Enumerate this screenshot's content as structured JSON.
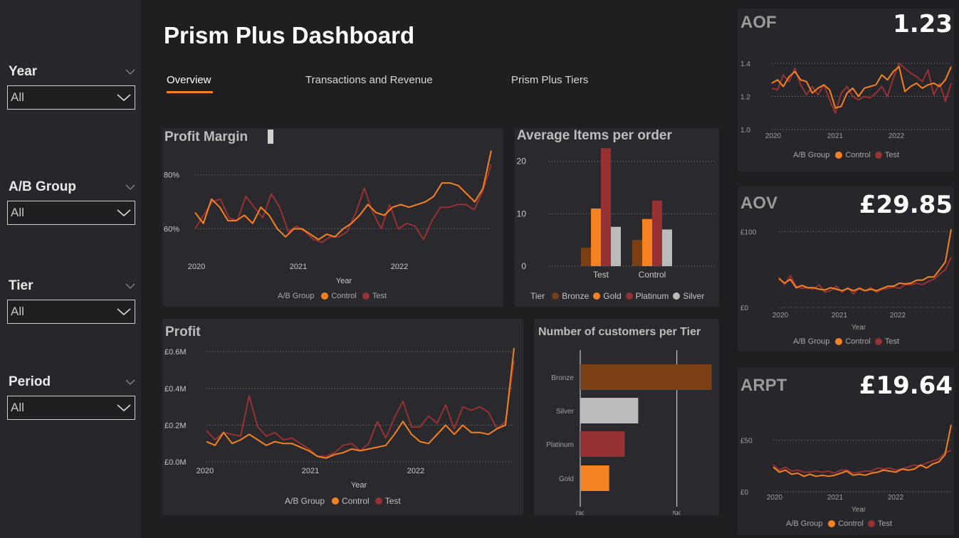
{
  "dashboard": {
    "title": "Prism Plus Dashboard",
    "tabs": [
      "Overview",
      "Transactions and Revenue",
      "Prism Plus Tiers"
    ],
    "active_tab": "Overview"
  },
  "filters": [
    {
      "label": "Year",
      "value": "All"
    },
    {
      "label": "A/B Group",
      "value": "All"
    },
    {
      "label": "Tier",
      "value": "All"
    },
    {
      "label": "Period",
      "value": "All"
    }
  ],
  "colors": {
    "control": "#f58220",
    "test": "#963233",
    "bronze": "#7a3f12",
    "gold": "#f58220",
    "platinum": "#963233",
    "silver": "#bbbbbb"
  },
  "legend": {
    "ab_title": "A/B Group",
    "control": "Control",
    "test": "Test",
    "tier_title": "Tier"
  },
  "profit_margin": {
    "title": "Profit Margin",
    "xlabel": "Year",
    "chart_data": {
      "type": "line",
      "x_ticks": [
        "2020",
        "2021",
        "2022"
      ],
      "y_ticks": [
        "60%",
        "80%"
      ],
      "ylim": [
        53,
        91
      ],
      "series": [
        {
          "name": "Control",
          "values": [
            66,
            62,
            71,
            68,
            63,
            63,
            65,
            62,
            68,
            65,
            60,
            57,
            60,
            60,
            58,
            56,
            58,
            57,
            60,
            62,
            65,
            69,
            66,
            65,
            68,
            69,
            68,
            69,
            70,
            72,
            77,
            77,
            76,
            73,
            70,
            75,
            89
          ]
        },
        {
          "name": "Test",
          "values": [
            60,
            65,
            70,
            71,
            64,
            63,
            72,
            68,
            64,
            73,
            68,
            59,
            61,
            59,
            56,
            55,
            57,
            57,
            59,
            66,
            75,
            66,
            60,
            69,
            60,
            62,
            61,
            56,
            63,
            68,
            68,
            69,
            69,
            67,
            74,
            84
          ]
        }
      ]
    }
  },
  "avg_items": {
    "title": "Average Items per order",
    "chart_data": {
      "type": "bar",
      "categories": [
        "Test",
        "Control"
      ],
      "y_ticks": [
        "0",
        "10",
        "20"
      ],
      "ylim": [
        0,
        22
      ],
      "series": [
        {
          "name": "Bronze",
          "values": [
            3.5,
            5.0
          ]
        },
        {
          "name": "Gold",
          "values": [
            11.0,
            9.0
          ]
        },
        {
          "name": "Platinum",
          "values": [
            22.5,
            12.5
          ]
        },
        {
          "name": "Silver",
          "values": [
            7.5,
            7.0
          ]
        }
      ]
    }
  },
  "profit": {
    "title": "Profit",
    "xlabel": "Year",
    "chart_data": {
      "type": "line",
      "x_ticks": [
        "2020",
        "2021",
        "2022"
      ],
      "y_ticks": [
        "£0.0M",
        "£0.2M",
        "£0.4M",
        "£0.6M"
      ],
      "ylim": [
        0,
        0.62
      ],
      "series": [
        {
          "name": "Control",
          "values": [
            0.11,
            0.09,
            0.16,
            0.1,
            0.12,
            0.15,
            0.12,
            0.09,
            0.11,
            0.1,
            0.1,
            0.08,
            0.06,
            0.03,
            0.02,
            0.04,
            0.05,
            0.07,
            0.06,
            0.07,
            0.08,
            0.09,
            0.15,
            0.22,
            0.15,
            0.11,
            0.1,
            0.15,
            0.2,
            0.15,
            0.2,
            0.16,
            0.16,
            0.15,
            0.18,
            0.2,
            0.62
          ]
        },
        {
          "name": "Test",
          "values": [
            0.17,
            0.12,
            0.16,
            0.15,
            0.14,
            0.36,
            0.19,
            0.14,
            0.16,
            0.12,
            0.13,
            0.1,
            0.07,
            0.03,
            0.03,
            0.05,
            0.09,
            0.1,
            0.06,
            0.1,
            0.22,
            0.13,
            0.24,
            0.33,
            0.19,
            0.19,
            0.25,
            0.21,
            0.31,
            0.18,
            0.3,
            0.28,
            0.3,
            0.27,
            0.18,
            0.22,
            0.55
          ]
        }
      ]
    }
  },
  "customers_per_tier": {
    "title": "Number of customers per Tier",
    "chart_data": {
      "type": "bar",
      "orientation": "horizontal",
      "categories": [
        "Bronze",
        "Silver",
        "Platinum",
        "Gold"
      ],
      "values": [
        6800,
        3000,
        2300,
        1500
      ],
      "x_ticks": [
        "0K",
        "5K"
      ],
      "xlim": [
        0,
        7000
      ]
    }
  },
  "kpis": [
    {
      "name": "AOF",
      "value": "1.23",
      "xlabel": "",
      "chart_data": {
        "type": "line",
        "x_ticks": [
          "2020",
          "2021",
          "2022"
        ],
        "y_ticks": [
          "1.0",
          "1.2",
          "1.4"
        ],
        "ylim": [
          1.0,
          1.4
        ],
        "series": [
          {
            "name": "Control",
            "values": [
              1.28,
              1.3,
              1.26,
              1.32,
              1.35,
              1.3,
              1.29,
              1.22,
              1.25,
              1.27,
              1.24,
              1.13,
              1.14,
              1.22,
              1.25,
              1.2,
              1.25,
              1.26,
              1.27,
              1.33,
              1.3,
              1.35,
              1.38,
              1.23,
              1.26,
              1.28,
              1.25,
              1.27,
              1.28,
              1.26,
              1.3,
              1.38
            ]
          },
          {
            "name": "Test",
            "values": [
              1.25,
              1.24,
              1.33,
              1.29,
              1.37,
              1.27,
              1.21,
              1.26,
              1.21,
              1.27,
              1.18,
              1.1,
              1.22,
              1.26,
              1.2,
              1.18,
              1.2,
              1.19,
              1.22,
              1.26,
              1.2,
              1.31,
              1.4,
              1.37,
              1.34,
              1.32,
              1.29,
              1.36,
              1.21,
              1.28,
              1.17,
              1.28
            ]
          }
        ]
      }
    },
    {
      "name": "AOV",
      "value": "£29.85",
      "xlabel": "Year",
      "chart_data": {
        "type": "line",
        "x_ticks": [
          "2020",
          "2021",
          "2022"
        ],
        "y_ticks": [
          "£0",
          "£100"
        ],
        "ylim": [
          0,
          105
        ],
        "series": [
          {
            "name": "Control",
            "values": [
              38,
              32,
              37,
              26,
              29,
              26,
              26,
              24,
              23,
              26,
              24,
              22,
              25,
              22,
              25,
              22,
              24,
              22,
              25,
              28,
              28,
              32,
              31,
              32,
              36,
              36,
              40,
              40,
              50,
              60,
              103
            ]
          },
          {
            "name": "Test",
            "values": [
              40,
              30,
              42,
              28,
              25,
              26,
              24,
              30,
              20,
              22,
              28,
              20,
              26,
              18,
              26,
              22,
              26,
              20,
              24,
              25,
              27,
              25,
              30,
              30,
              32,
              30,
              34,
              37,
              44,
              50,
              66
            ]
          }
        ]
      }
    },
    {
      "name": "ARPT",
      "value": "£19.64",
      "xlabel": "Year",
      "chart_data": {
        "type": "line",
        "x_ticks": [
          "2020",
          "2021",
          "2022"
        ],
        "y_ticks": [
          "£0",
          "£50"
        ],
        "ylim": [
          0,
          67
        ],
        "series": [
          {
            "name": "Control",
            "values": [
              24,
              19,
              21,
              17,
              18,
              15,
              17,
              15,
              16,
              15,
              16,
              18,
              20,
              16,
              17,
              16,
              18,
              19,
              21,
              20,
              19,
              22,
              21,
              22,
              26,
              23,
              27,
              29,
              36,
              65
            ]
          },
          {
            "name": "Test",
            "values": [
              26,
              21,
              24,
              20,
              21,
              19,
              19,
              20,
              19,
              20,
              18,
              21,
              21,
              18,
              19,
              20,
              20,
              23,
              22,
              23,
              21,
              22,
              24,
              26,
              25,
              28,
              30,
              32,
              38,
              40
            ]
          }
        ]
      }
    }
  ]
}
